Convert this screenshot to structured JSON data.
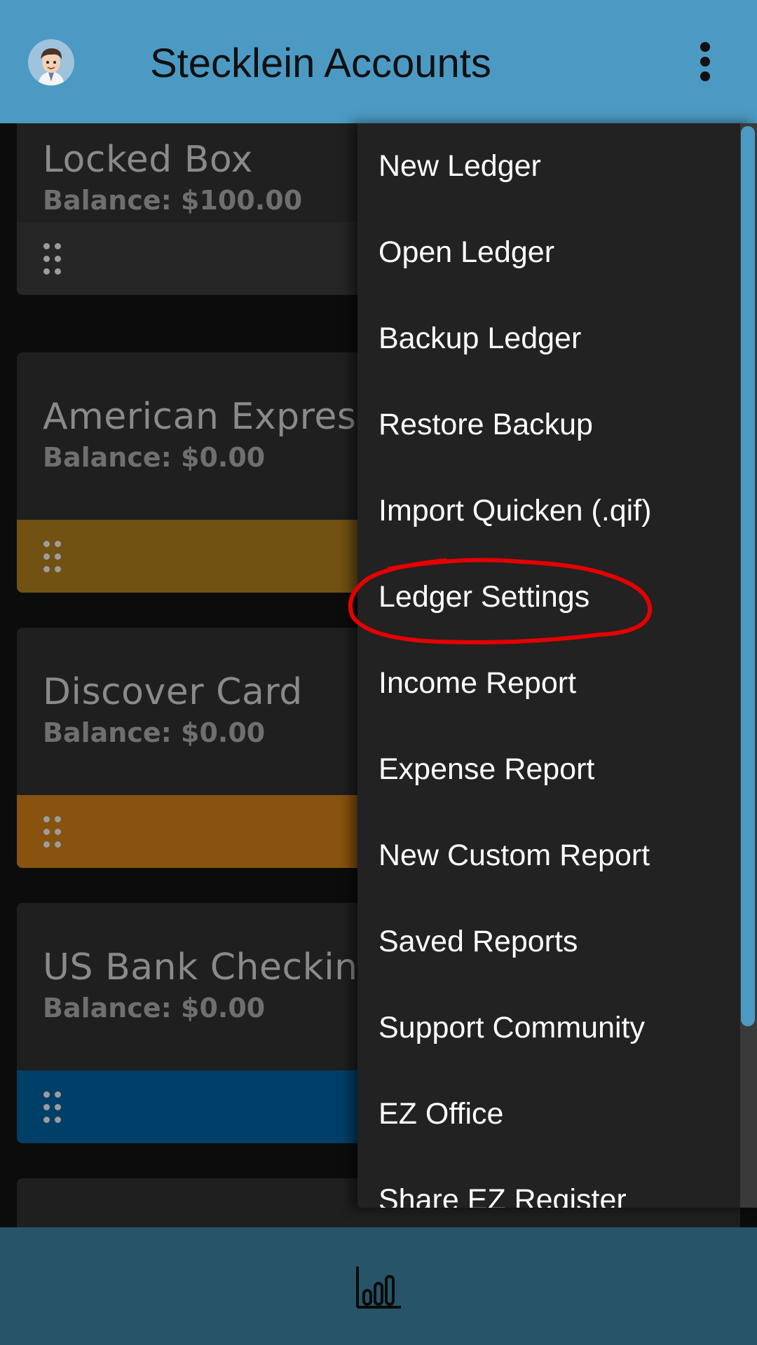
{
  "app_bar": {
    "title": "Stecklein Accounts",
    "avatar_icon": "user-avatar-icon",
    "overflow_icon": "more-vert-icon"
  },
  "accounts": [
    {
      "name": "Locked Box",
      "balance": "Balance: $100.00",
      "color": "#262626"
    },
    {
      "name": "American Express",
      "balance": "Balance: $0.00",
      "color": "#715213"
    },
    {
      "name": "Discover Card",
      "balance": "Balance: $0.00",
      "color": "#87530f"
    },
    {
      "name": "US Bank Checking",
      "balance": "Balance: $0.00",
      "color": "#003f68"
    }
  ],
  "menu": {
    "items": [
      "New Ledger",
      "Open Ledger",
      "Backup Ledger",
      "Restore Backup",
      "Import Quicken (.qif)",
      "Ledger Settings",
      "Income Report",
      "Expense Report",
      "New Custom Report",
      "Saved Reports",
      "Support Community",
      "EZ Office",
      "Share EZ Register"
    ],
    "highlighted_item": "Ledger Settings",
    "highlight_color": "#e50000"
  },
  "bottom_bar": {
    "icon": "bar-chart-icon"
  },
  "colors": {
    "app_bar": "#4c9ac4",
    "bottom_bar": "#285468",
    "menu_background": "#222222"
  }
}
